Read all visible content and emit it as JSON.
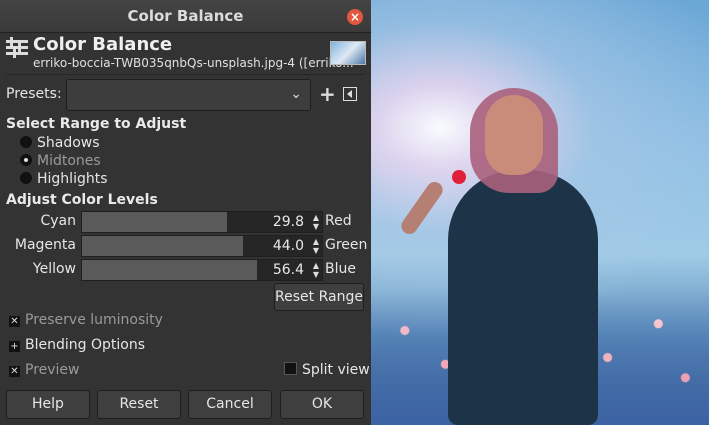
{
  "window": {
    "title": "Color Balance"
  },
  "header": {
    "title": "Color Balance",
    "subtitle": "erriko-boccia-TWB035qnbQs-unsplash.jpg-4 ([erriko..."
  },
  "presets": {
    "label": "Presets:",
    "value": ""
  },
  "range": {
    "title": "Select Range to Adjust",
    "options": [
      "Shadows",
      "Midtones",
      "Highlights"
    ],
    "selected": "Midtones"
  },
  "levels": {
    "title": "Adjust Color Levels",
    "rows": [
      {
        "left": "Cyan",
        "right": "Red",
        "value": "29.8"
      },
      {
        "left": "Magenta",
        "right": "Green",
        "value": "44.0"
      },
      {
        "left": "Yellow",
        "right": "Blue",
        "value": "56.4"
      }
    ],
    "reset_label": "Reset Range"
  },
  "options": {
    "preserve_luminosity": "Preserve luminosity",
    "blending_options": "Blending Options",
    "preview": "Preview",
    "split_view": "Split view"
  },
  "buttons": {
    "help": "Help",
    "reset": "Reset",
    "cancel": "Cancel",
    "ok": "OK"
  }
}
